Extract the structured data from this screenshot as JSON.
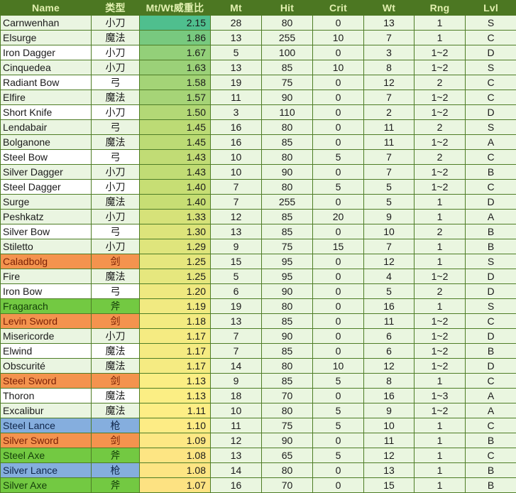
{
  "table": {
    "columns": [
      {
        "key": "name",
        "label": "Name"
      },
      {
        "key": "type",
        "label": "类型"
      },
      {
        "key": "ratio",
        "label": "Mt/Wt威重比"
      },
      {
        "key": "mt",
        "label": "Mt"
      },
      {
        "key": "hit",
        "label": "Hit"
      },
      {
        "key": "crit",
        "label": "Crit"
      },
      {
        "key": "wt",
        "label": "Wt"
      },
      {
        "key": "rng",
        "label": "Rng"
      },
      {
        "key": "lvl",
        "label": "Lvl"
      }
    ],
    "colors": {
      "header_bg": "#4c7722",
      "header_text": "#e2f0b0",
      "grid_line": "#4e7d26",
      "row_tint_a": "#eaf5e1",
      "row_tint_b": "#ffffff",
      "data_cell_bg": "#eaf6e0",
      "cat_sword_bg": "#f4934e",
      "cat_sword_text": "#7a1f05",
      "cat_axe_bg": "#73c942",
      "cat_axe_text": "#15400a",
      "cat_lance_bg": "#85aede",
      "cat_lance_text": "#10264a",
      "ratio_scale_high": "#4bb98a",
      "ratio_scale_mid": "#c4dd7d",
      "ratio_scale_low": "#fcda7a"
    },
    "rows": [
      {
        "name": "Carnwenhan",
        "type": "小刀",
        "ratio": "2.15",
        "mt": "28",
        "hit": "80",
        "crit": "0",
        "wt": "13",
        "rng": "1",
        "lvl": "S",
        "ratio_bg": "#4fbf8e",
        "cat": "none",
        "tint": "a"
      },
      {
        "name": "Elsurge",
        "type": "魔法",
        "ratio": "1.86",
        "mt": "13",
        "hit": "255",
        "crit": "10",
        "wt": "7",
        "rng": "1",
        "lvl": "C",
        "ratio_bg": "#78c97f",
        "cat": "none",
        "tint": "a"
      },
      {
        "name": "Iron Dagger",
        "type": "小刀",
        "ratio": "1.67",
        "mt": "5",
        "hit": "100",
        "crit": "0",
        "wt": "3",
        "rng": "1~2",
        "lvl": "D",
        "ratio_bg": "#93d079",
        "cat": "none",
        "tint": "b"
      },
      {
        "name": "Cinquedea",
        "type": "小刀",
        "ratio": "1.63",
        "mt": "13",
        "hit": "85",
        "crit": "10",
        "wt": "8",
        "rng": "1~2",
        "lvl": "S",
        "ratio_bg": "#9bd178",
        "cat": "none",
        "tint": "a"
      },
      {
        "name": "Radiant Bow",
        "type": "弓",
        "ratio": "1.58",
        "mt": "19",
        "hit": "75",
        "crit": "0",
        "wt": "12",
        "rng": "2",
        "lvl": "C",
        "ratio_bg": "#a4d477",
        "cat": "none",
        "tint": "b"
      },
      {
        "name": "Elfire",
        "type": "魔法",
        "ratio": "1.57",
        "mt": "11",
        "hit": "90",
        "crit": "0",
        "wt": "7",
        "rng": "1~2",
        "lvl": "C",
        "ratio_bg": "#a6d477",
        "cat": "none",
        "tint": "a"
      },
      {
        "name": "Short Knife",
        "type": "小刀",
        "ratio": "1.50",
        "mt": "3",
        "hit": "110",
        "crit": "0",
        "wt": "2",
        "rng": "1~2",
        "lvl": "D",
        "ratio_bg": "#b3d876",
        "cat": "none",
        "tint": "b"
      },
      {
        "name": "Lendabair",
        "type": "弓",
        "ratio": "1.45",
        "mt": "16",
        "hit": "80",
        "crit": "0",
        "wt": "11",
        "rng": "2",
        "lvl": "S",
        "ratio_bg": "#bcdb75",
        "cat": "none",
        "tint": "a"
      },
      {
        "name": "Bolganone",
        "type": "魔法",
        "ratio": "1.45",
        "mt": "16",
        "hit": "85",
        "crit": "0",
        "wt": "11",
        "rng": "1~2",
        "lvl": "A",
        "ratio_bg": "#bcdb75",
        "cat": "none",
        "tint": "a"
      },
      {
        "name": "Steel Bow",
        "type": "弓",
        "ratio": "1.43",
        "mt": "10",
        "hit": "80",
        "crit": "5",
        "wt": "7",
        "rng": "2",
        "lvl": "C",
        "ratio_bg": "#c1dc75",
        "cat": "none",
        "tint": "b"
      },
      {
        "name": "Silver Dagger",
        "type": "小刀",
        "ratio": "1.43",
        "mt": "10",
        "hit": "90",
        "crit": "0",
        "wt": "7",
        "rng": "1~2",
        "lvl": "B",
        "ratio_bg": "#c1dc75",
        "cat": "none",
        "tint": "a"
      },
      {
        "name": "Steel Dagger",
        "type": "小刀",
        "ratio": "1.40",
        "mt": "7",
        "hit": "80",
        "crit": "5",
        "wt": "5",
        "rng": "1~2",
        "lvl": "C",
        "ratio_bg": "#c7de74",
        "cat": "none",
        "tint": "b"
      },
      {
        "name": "Surge",
        "type": "魔法",
        "ratio": "1.40",
        "mt": "7",
        "hit": "255",
        "crit": "0",
        "wt": "5",
        "rng": "1",
        "lvl": "D",
        "ratio_bg": "#c7de74",
        "cat": "none",
        "tint": "a"
      },
      {
        "name": "Peshkatz",
        "type": "小刀",
        "ratio": "1.33",
        "mt": "12",
        "hit": "85",
        "crit": "20",
        "wt": "9",
        "rng": "1",
        "lvl": "A",
        "ratio_bg": "#d6e279",
        "cat": "none",
        "tint": "a"
      },
      {
        "name": "Silver Bow",
        "type": "弓",
        "ratio": "1.30",
        "mt": "13",
        "hit": "85",
        "crit": "0",
        "wt": "10",
        "rng": "2",
        "lvl": "B",
        "ratio_bg": "#dde47b",
        "cat": "none",
        "tint": "b"
      },
      {
        "name": "Stiletto",
        "type": "小刀",
        "ratio": "1.29",
        "mt": "9",
        "hit": "75",
        "crit": "15",
        "wt": "7",
        "rng": "1",
        "lvl": "B",
        "ratio_bg": "#dfe57c",
        "cat": "none",
        "tint": "a"
      },
      {
        "name": "Caladbolg",
        "type": "剑",
        "ratio": "1.25",
        "mt": "15",
        "hit": "95",
        "crit": "0",
        "wt": "12",
        "rng": "1",
        "lvl": "S",
        "ratio_bg": "#e6e77e",
        "cat": "sword",
        "tint": "a"
      },
      {
        "name": "Fire",
        "type": "魔法",
        "ratio": "1.25",
        "mt": "5",
        "hit": "95",
        "crit": "0",
        "wt": "4",
        "rng": "1~2",
        "lvl": "D",
        "ratio_bg": "#e6e77e",
        "cat": "none",
        "tint": "a"
      },
      {
        "name": "Iron Bow",
        "type": "弓",
        "ratio": "1.20",
        "mt": "6",
        "hit": "90",
        "crit": "0",
        "wt": "5",
        "rng": "2",
        "lvl": "D",
        "ratio_bg": "#efe980",
        "cat": "none",
        "tint": "b"
      },
      {
        "name": "Fragarach",
        "type": "斧",
        "ratio": "1.19",
        "mt": "19",
        "hit": "80",
        "crit": "0",
        "wt": "16",
        "rng": "1",
        "lvl": "S",
        "ratio_bg": "#f1ea81",
        "cat": "axe",
        "tint": "a"
      },
      {
        "name": "Levin Sword",
        "type": "剑",
        "ratio": "1.18",
        "mt": "13",
        "hit": "85",
        "crit": "0",
        "wt": "11",
        "rng": "1~2",
        "lvl": "C",
        "ratio_bg": "#f3eb81",
        "cat": "sword",
        "tint": "a"
      },
      {
        "name": "Misericorde",
        "type": "小刀",
        "ratio": "1.17",
        "mt": "7",
        "hit": "90",
        "crit": "0",
        "wt": "6",
        "rng": "1~2",
        "lvl": "D",
        "ratio_bg": "#f5eb82",
        "cat": "none",
        "tint": "a"
      },
      {
        "name": "Elwind",
        "type": "魔法",
        "ratio": "1.17",
        "mt": "7",
        "hit": "85",
        "crit": "0",
        "wt": "6",
        "rng": "1~2",
        "lvl": "B",
        "ratio_bg": "#f5eb82",
        "cat": "none",
        "tint": "b"
      },
      {
        "name": "Obscurité",
        "type": "魔法",
        "ratio": "1.17",
        "mt": "14",
        "hit": "80",
        "crit": "10",
        "wt": "12",
        "rng": "1~2",
        "lvl": "D",
        "ratio_bg": "#f5eb82",
        "cat": "none",
        "tint": "a"
      },
      {
        "name": "Steel Sword",
        "type": "剑",
        "ratio": "1.13",
        "mt": "9",
        "hit": "85",
        "crit": "5",
        "wt": "8",
        "rng": "1",
        "lvl": "C",
        "ratio_bg": "#fbee84",
        "cat": "sword",
        "tint": "a"
      },
      {
        "name": "Thoron",
        "type": "魔法",
        "ratio": "1.13",
        "mt": "18",
        "hit": "70",
        "crit": "0",
        "wt": "16",
        "rng": "1~3",
        "lvl": "A",
        "ratio_bg": "#fbee84",
        "cat": "none",
        "tint": "b"
      },
      {
        "name": "Excalibur",
        "type": "魔法",
        "ratio": "1.11",
        "mt": "10",
        "hit": "80",
        "crit": "5",
        "wt": "9",
        "rng": "1~2",
        "lvl": "A",
        "ratio_bg": "#fdee85",
        "cat": "none",
        "tint": "a"
      },
      {
        "name": "Steel Lance",
        "type": "枪",
        "ratio": "1.10",
        "mt": "11",
        "hit": "75",
        "crit": "5",
        "wt": "10",
        "rng": "1",
        "lvl": "C",
        "ratio_bg": "#fdec85",
        "cat": "lance",
        "tint": "a"
      },
      {
        "name": "Silver Sword",
        "type": "剑",
        "ratio": "1.09",
        "mt": "12",
        "hit": "90",
        "crit": "0",
        "wt": "11",
        "rng": "1",
        "lvl": "B",
        "ratio_bg": "#fde884",
        "cat": "sword",
        "tint": "a"
      },
      {
        "name": "Steel Axe",
        "type": "斧",
        "ratio": "1.08",
        "mt": "13",
        "hit": "65",
        "crit": "5",
        "wt": "12",
        "rng": "1",
        "lvl": "C",
        "ratio_bg": "#fde583",
        "cat": "axe",
        "tint": "a"
      },
      {
        "name": "Silver Lance",
        "type": "枪",
        "ratio": "1.08",
        "mt": "14",
        "hit": "80",
        "crit": "0",
        "wt": "13",
        "rng": "1",
        "lvl": "B",
        "ratio_bg": "#fde583",
        "cat": "lance",
        "tint": "a"
      },
      {
        "name": "Silver Axe",
        "type": "斧",
        "ratio": "1.07",
        "mt": "16",
        "hit": "70",
        "crit": "0",
        "wt": "15",
        "rng": "1",
        "lvl": "B",
        "ratio_bg": "#fde282",
        "cat": "axe",
        "tint": "a"
      }
    ]
  }
}
